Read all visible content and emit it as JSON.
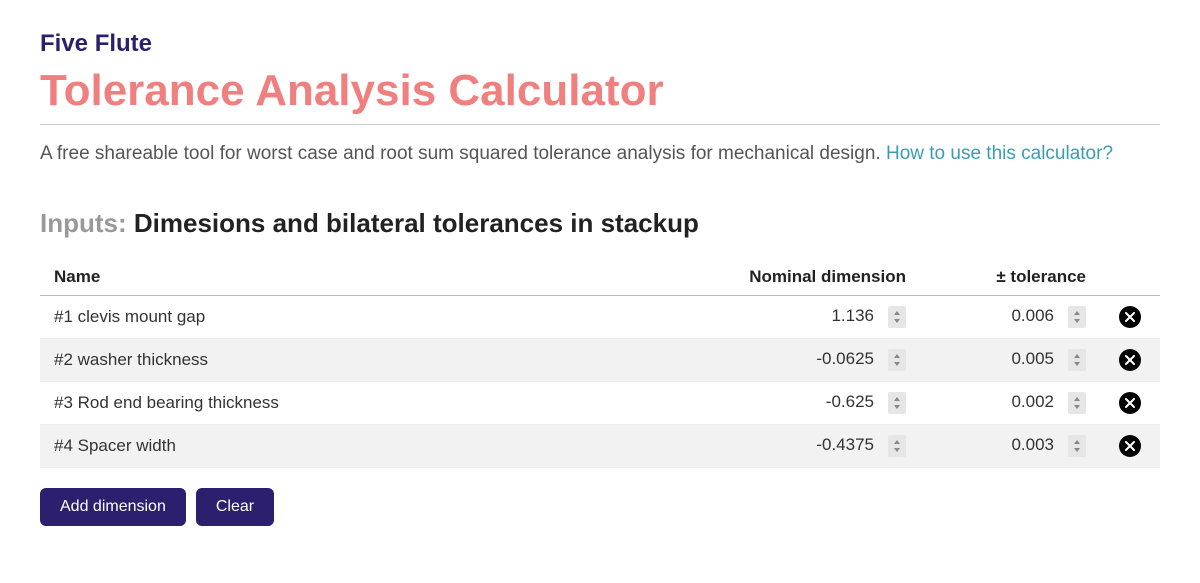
{
  "brand": "Five Flute",
  "title": "Tolerance Analysis Calculator",
  "description_text": "A free shareable tool for worst case and root sum squared tolerance analysis for mechanical design. ",
  "description_link": "How to use this calculator?",
  "inputs": {
    "label": "Inputs:",
    "detail": "Dimesions and bilateral tolerances in stackup"
  },
  "columns": {
    "name": "Name",
    "nominal": "Nominal dimension",
    "tolerance": "± tolerance"
  },
  "rows": [
    {
      "name": "#1 clevis mount gap",
      "nominal": "1.136",
      "tolerance": "0.006"
    },
    {
      "name": "#2 washer thickness",
      "nominal": "-0.0625",
      "tolerance": "0.005"
    },
    {
      "name": "#3 Rod end bearing thickness",
      "nominal": "-0.625",
      "tolerance": "0.002"
    },
    {
      "name": "#4 Spacer width",
      "nominal": "-0.4375",
      "tolerance": "0.003"
    }
  ],
  "buttons": {
    "add": "Add dimension",
    "clear": "Clear"
  }
}
